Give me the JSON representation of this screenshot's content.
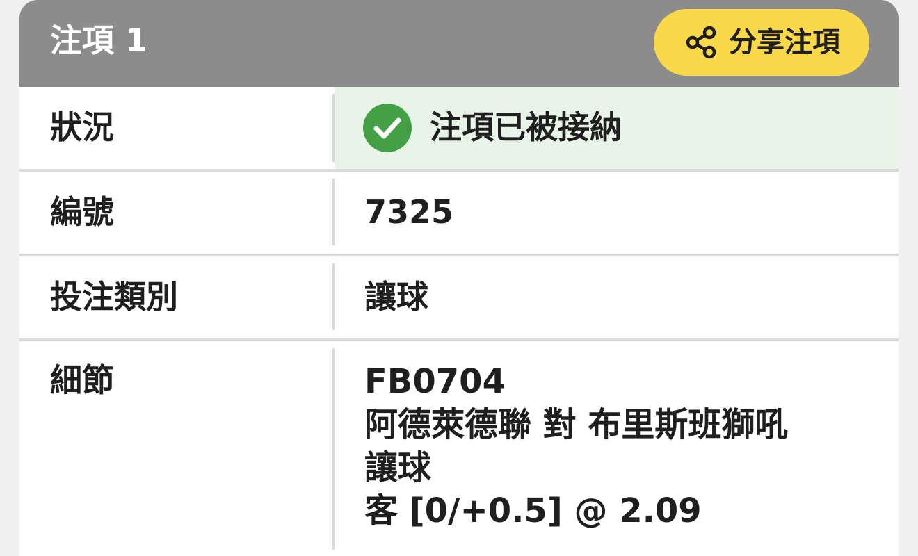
{
  "header": {
    "title": "注項 1",
    "share_button_label": "分享注項",
    "share_icon": "share-icon"
  },
  "rows": {
    "status": {
      "label": "狀況",
      "value": "注項已被接納",
      "icon": "check-circle-icon",
      "status_color": "#43a047",
      "status_bg_color": "#e8f4e8"
    },
    "number": {
      "label": "編號",
      "value": "7325"
    },
    "bet_type": {
      "label": "投注類別",
      "value": "讓球"
    },
    "details": {
      "label": "細節",
      "lines": [
        "FB0704",
        "阿德萊德聯 對 布里斯班獅吼",
        "讓球",
        "客 [0/+0.5] @ 2.09"
      ]
    }
  },
  "colors": {
    "header_bg": "#8c8c8c",
    "accent_button": "#f9d84a"
  }
}
